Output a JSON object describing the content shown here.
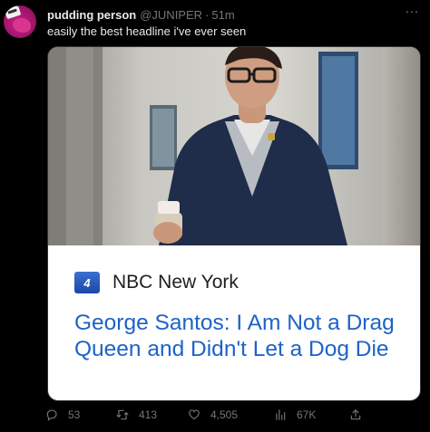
{
  "tweet": {
    "display_name": "pudding person",
    "handle": "@JUNIPER",
    "separator": "·",
    "time": "51m",
    "text": "easily the best headline i've ever seen",
    "more_icon": "more-horizontal-icon"
  },
  "card": {
    "source_logo_text": "4",
    "source_name": "NBC New York",
    "headline": "George Santos: I Am Not a Drag Queen and Didn't Let a Dog Die"
  },
  "actions": {
    "replies": "53",
    "retweets": "413",
    "likes": "4,505",
    "views": "67K"
  },
  "colors": {
    "background": "#000000",
    "muted": "#71767b",
    "headline": "#1d63c7",
    "avatar": "#b5187a"
  }
}
